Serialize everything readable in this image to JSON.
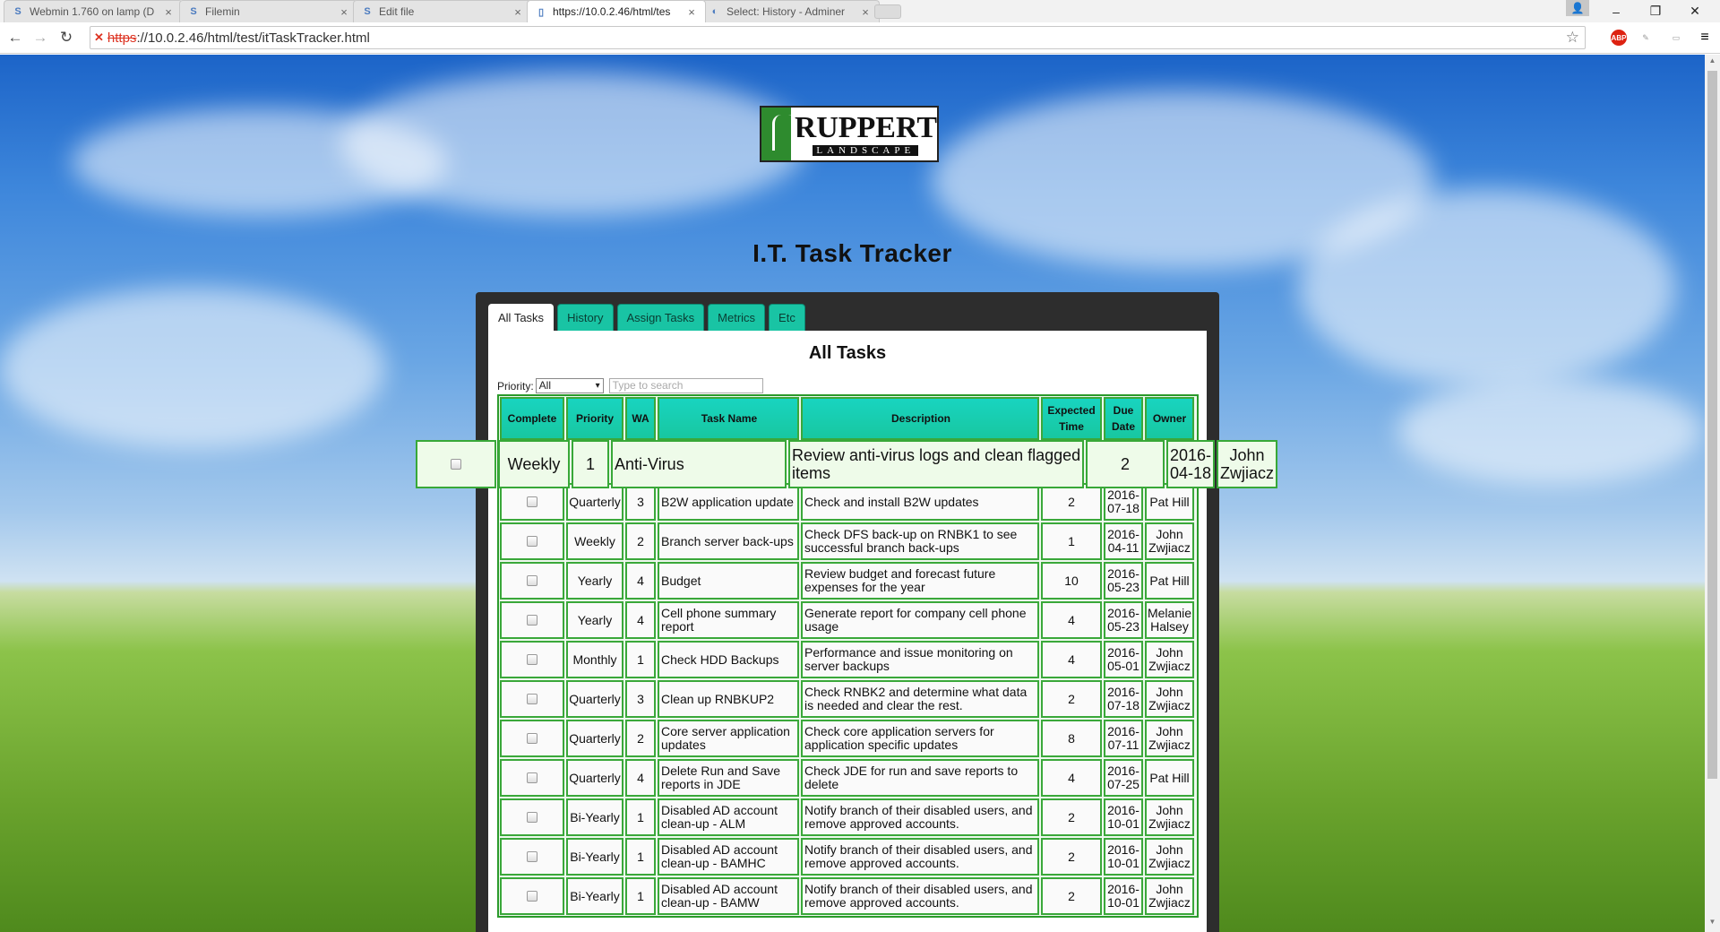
{
  "browser": {
    "tabs": [
      {
        "title": "Webmin 1.760 on lamp (D",
        "icon": "webmin-icon"
      },
      {
        "title": "Filemin",
        "icon": "webmin-icon"
      },
      {
        "title": "Edit file",
        "icon": "webmin-icon"
      },
      {
        "title": "https://10.0.2.46/html/tes",
        "icon": "page-icon"
      },
      {
        "title": "Select: History - Adminer",
        "icon": "adminer-icon"
      }
    ],
    "url_protocol": "https",
    "url_rest": "://10.0.2.46/html/test/itTaskTracker.html",
    "abp_label": "ABP"
  },
  "logo": {
    "brand": "RUPPERT",
    "sub": "LANDSCAPE"
  },
  "page_title": "I.T. Task Tracker",
  "panel_tabs": [
    "All Tasks",
    "History",
    "Assign Tasks",
    "Metrics",
    "Etc"
  ],
  "section_title": "All Tasks",
  "filters": {
    "priority_label": "Priority:",
    "priority_value": "All",
    "search_placeholder": "Type to search"
  },
  "columns": [
    "Complete",
    "Priority",
    "WA",
    "Task Name",
    "Description",
    "Expected Time",
    "Due Date",
    "Owner"
  ],
  "dragged_row": {
    "priority": "Weekly",
    "wa": "1",
    "name": "Anti-Virus",
    "description": "Review anti-virus logs and clean flagged items",
    "expected": "2",
    "due": "2016-04-18",
    "owner": "John Zwjiacz"
  },
  "rows": [
    {
      "priority": "Quarterly",
      "wa": "3",
      "name": "B2W application update",
      "description": "Check and install B2W updates",
      "expected": "2",
      "due": "2016-07-18",
      "owner": "Pat Hill"
    },
    {
      "priority": "Weekly",
      "wa": "2",
      "name": "Branch server back-ups",
      "description": "Check DFS back-up on RNBK1 to see successful branch back-ups",
      "expected": "1",
      "due": "2016-04-11",
      "owner": "John Zwjiacz"
    },
    {
      "priority": "Yearly",
      "wa": "4",
      "name": "Budget",
      "description": "Review budget and forecast future expenses for the year",
      "expected": "10",
      "due": "2016-05-23",
      "owner": "Pat Hill"
    },
    {
      "priority": "Yearly",
      "wa": "4",
      "name": "Cell phone summary report",
      "description": "Generate report for company cell phone usage",
      "expected": "4",
      "due": "2016-05-23",
      "owner": "Melanie Halsey"
    },
    {
      "priority": "Monthly",
      "wa": "1",
      "name": "Check HDD Backups",
      "description": "Performance and issue monitoring on server backups",
      "expected": "4",
      "due": "2016-05-01",
      "owner": "John Zwjiacz"
    },
    {
      "priority": "Quarterly",
      "wa": "3",
      "name": "Clean up RNBKUP2",
      "description": "Check RNBK2 and determine what data is needed and clear the rest.",
      "expected": "2",
      "due": "2016-07-18",
      "owner": "John Zwjiacz"
    },
    {
      "priority": "Quarterly",
      "wa": "2",
      "name": "Core server application updates",
      "description": "Check core application servers for application specific updates",
      "expected": "8",
      "due": "2016-07-11",
      "owner": "John Zwjiacz"
    },
    {
      "priority": "Quarterly",
      "wa": "4",
      "name": "Delete Run and Save reports in JDE",
      "description": "Check JDE for run and save reports to delete",
      "expected": "4",
      "due": "2016-07-25",
      "owner": "Pat Hill"
    },
    {
      "priority": "Bi-Yearly",
      "wa": "1",
      "name": "Disabled AD account clean-up - ALM",
      "description": "Notify branch of their disabled users, and remove approved accounts.",
      "expected": "2",
      "due": "2016-10-01",
      "owner": "John Zwjiacz"
    },
    {
      "priority": "Bi-Yearly",
      "wa": "1",
      "name": "Disabled AD account clean-up - BAMHC",
      "description": "Notify branch of their disabled users, and remove approved accounts.",
      "expected": "2",
      "due": "2016-10-01",
      "owner": "John Zwjiacz"
    },
    {
      "priority": "Bi-Yearly",
      "wa": "1",
      "name": "Disabled AD account clean-up - BAMW",
      "description": "Notify branch of their disabled users, and remove approved accounts.",
      "expected": "2",
      "due": "2016-10-01",
      "owner": "John Zwjiacz"
    }
  ]
}
